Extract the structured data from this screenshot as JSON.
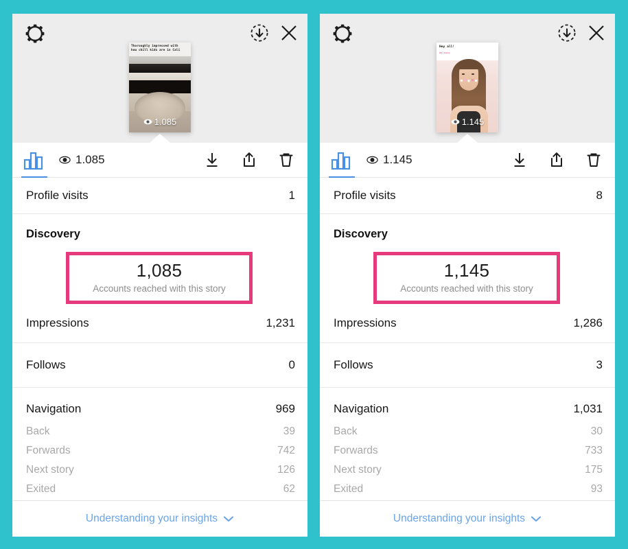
{
  "theme": {
    "page_background": "#2FC2CD",
    "panel_background": "#FFFFFF",
    "header_background": "#EDEDED",
    "highlight_pink": "#E63A7C",
    "accent_blue": "#4A90E2",
    "link_blue": "#6AA4E8",
    "muted_text": "#A8A8A8"
  },
  "panels": [
    {
      "id": "story-insights-left",
      "header": {
        "settings_icon": "gear-icon",
        "download_icon": "download-circle-icon",
        "close_icon": "close-icon",
        "thumbnail": {
          "caption": "Thoroughly impressed with\nhow chill kids are in Cali",
          "views_label": "1.085",
          "views_icon": "eye-icon"
        }
      },
      "actions": {
        "chart_icon": "bar-chart-icon",
        "views_icon": "eye-icon",
        "views_value": "1.085",
        "download_icon": "download-icon",
        "share_icon": "share-icon",
        "delete_icon": "trash-icon"
      },
      "profile_visits": {
        "label": "Profile visits",
        "value": "1"
      },
      "discovery": {
        "title": "Discovery",
        "reach_value": "1,085",
        "reach_label": "Accounts reached with this story"
      },
      "impressions": {
        "label": "Impressions",
        "value": "1,231"
      },
      "follows": {
        "label": "Follows",
        "value": "0"
      },
      "navigation": {
        "label": "Navigation",
        "value": "969",
        "items": [
          {
            "label": "Back",
            "value": "39"
          },
          {
            "label": "Forwards",
            "value": "742"
          },
          {
            "label": "Next story",
            "value": "126"
          },
          {
            "label": "Exited",
            "value": "62"
          }
        ]
      },
      "footer": {
        "label": "Understanding your insights",
        "chevron": "chevron-down-icon"
      }
    },
    {
      "id": "story-insights-right",
      "header": {
        "settings_icon": "gear-icon",
        "download_icon": "download-circle-icon",
        "close_icon": "close-icon",
        "thumbnail": {
          "caption": "Hey all!",
          "subcaption": "#glowup",
          "views_label": "1.145",
          "views_icon": "eye-icon"
        }
      },
      "actions": {
        "chart_icon": "bar-chart-icon",
        "views_icon": "eye-icon",
        "views_value": "1.145",
        "download_icon": "download-icon",
        "share_icon": "share-icon",
        "delete_icon": "trash-icon"
      },
      "profile_visits": {
        "label": "Profile visits",
        "value": "8"
      },
      "discovery": {
        "title": "Discovery",
        "reach_value": "1,145",
        "reach_label": "Accounts reached with this story"
      },
      "impressions": {
        "label": "Impressions",
        "value": "1,286"
      },
      "follows": {
        "label": "Follows",
        "value": "3"
      },
      "navigation": {
        "label": "Navigation",
        "value": "1,031",
        "items": [
          {
            "label": "Back",
            "value": "30"
          },
          {
            "label": "Forwards",
            "value": "733"
          },
          {
            "label": "Next story",
            "value": "175"
          },
          {
            "label": "Exited",
            "value": "93"
          }
        ]
      },
      "footer": {
        "label": "Understanding your insights",
        "chevron": "chevron-down-icon"
      }
    }
  ]
}
